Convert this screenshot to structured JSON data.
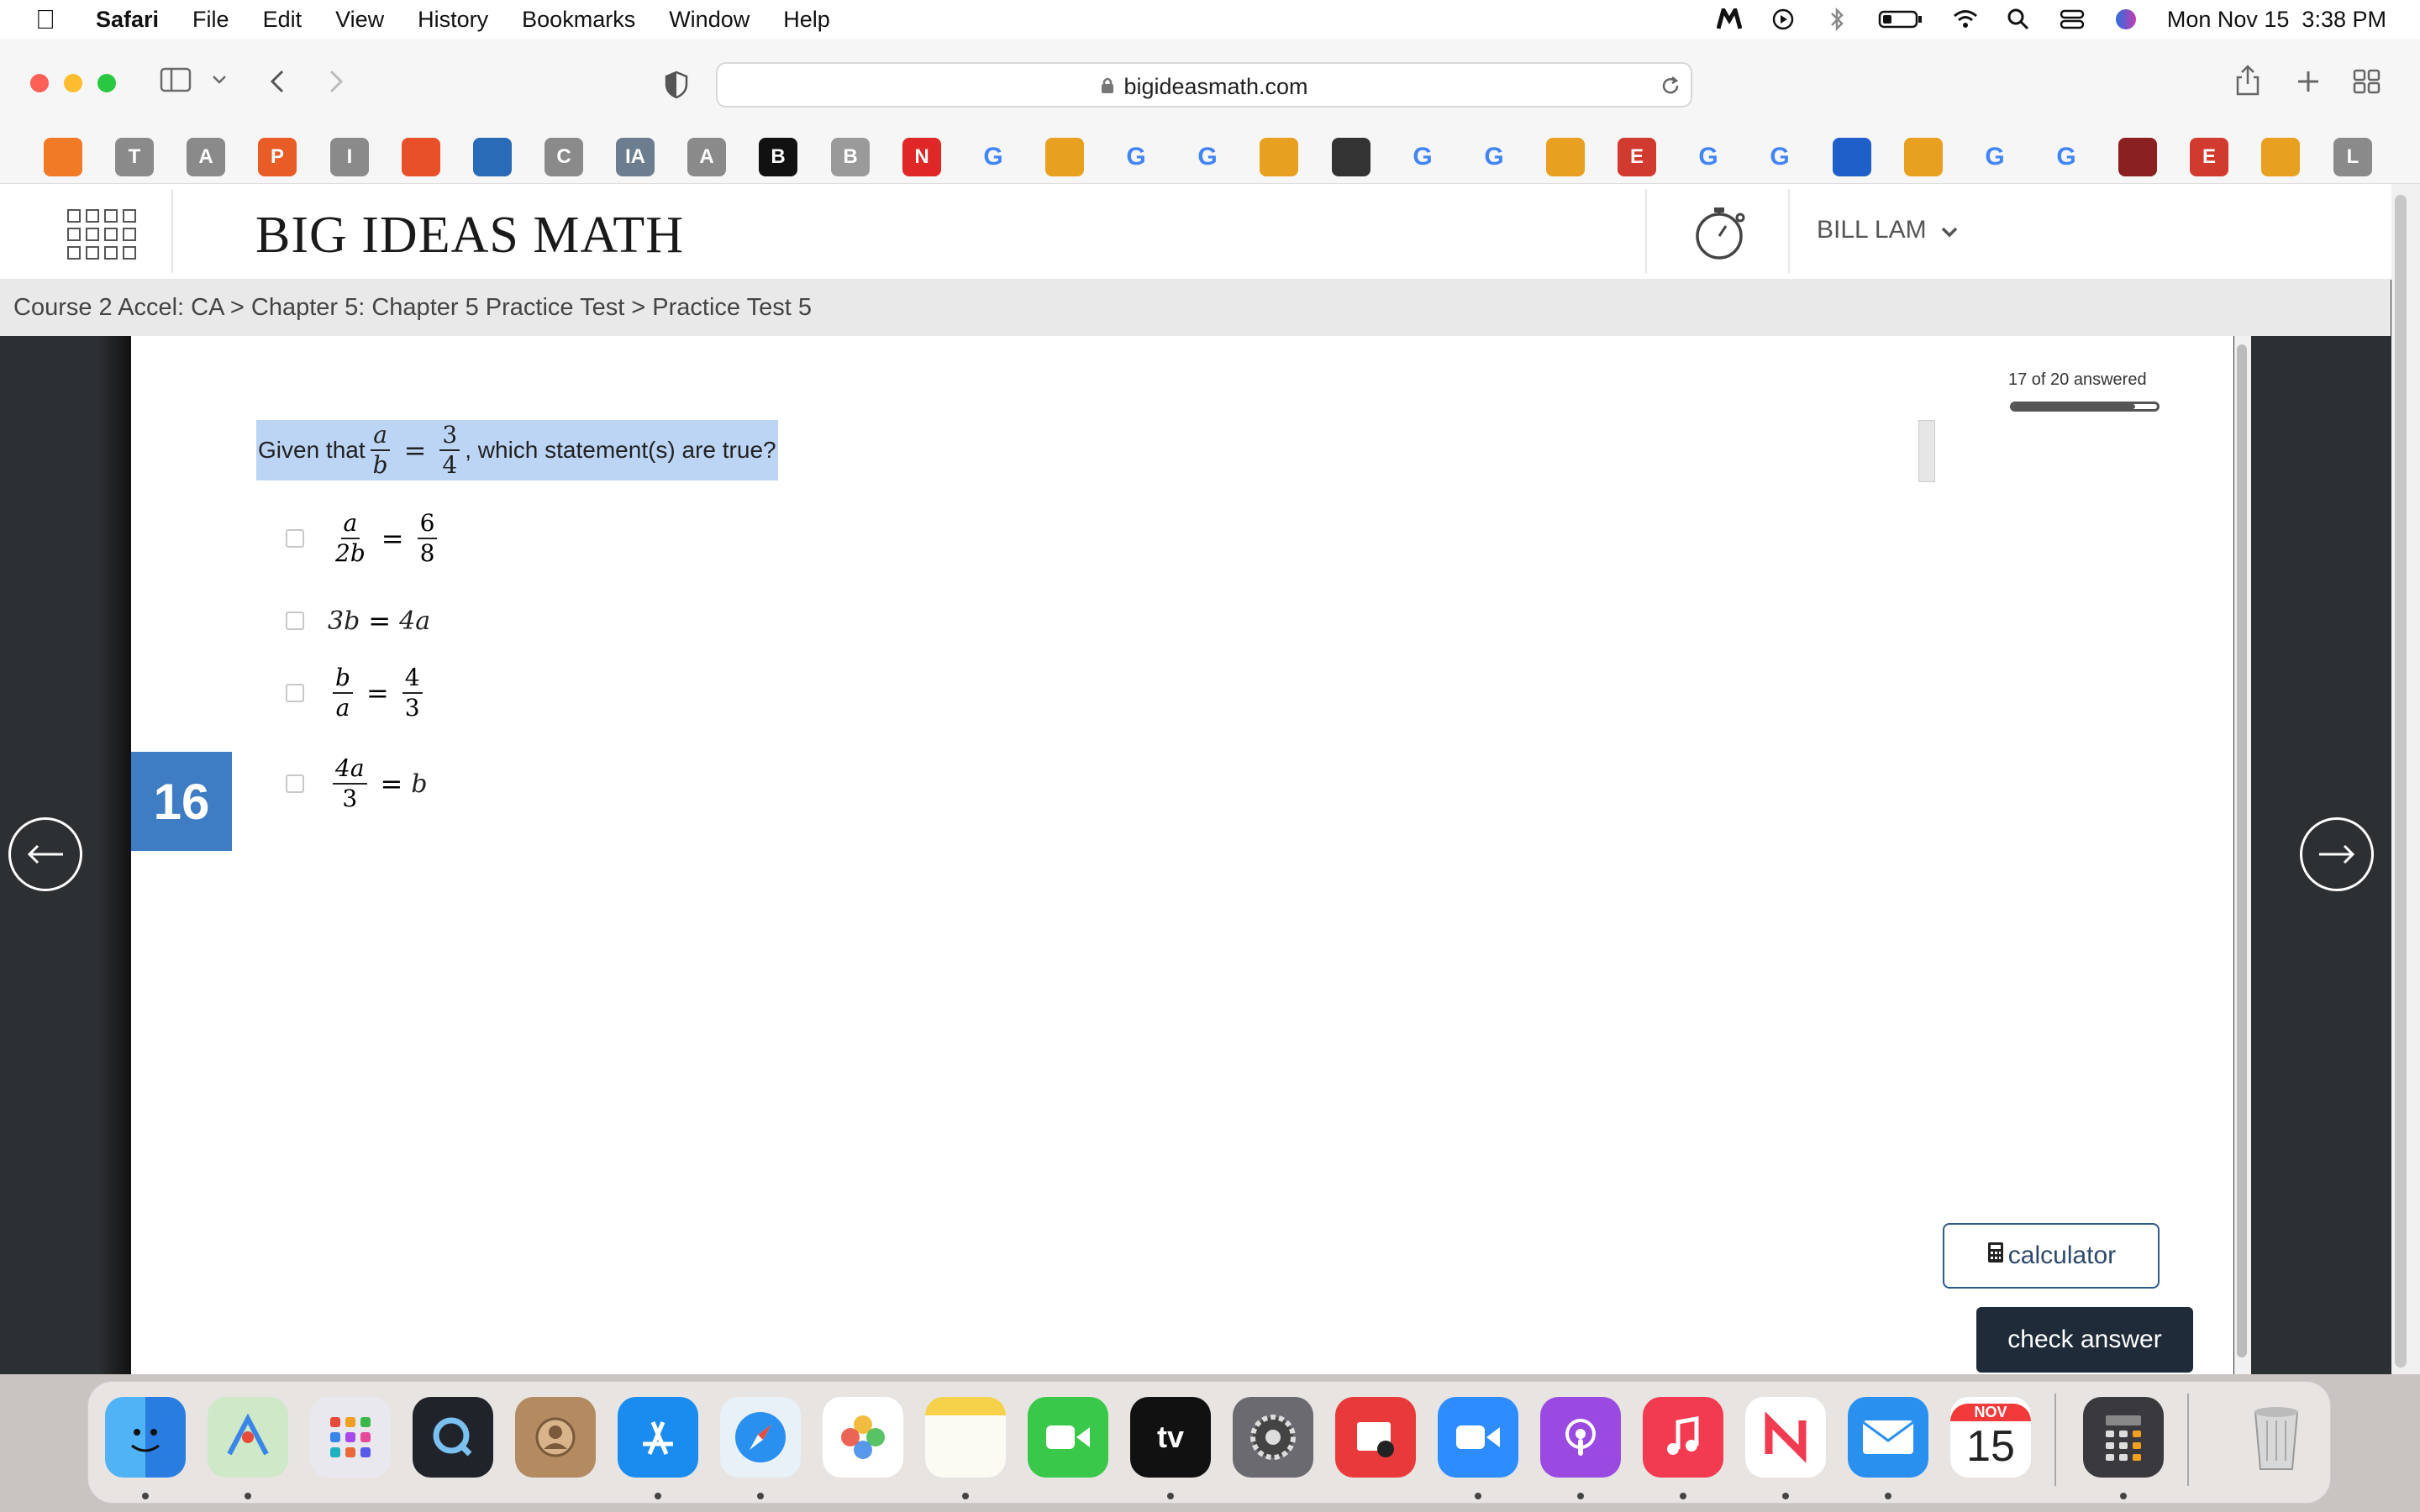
{
  "menubar": {
    "app": "Safari",
    "items": [
      "File",
      "Edit",
      "View",
      "History",
      "Bookmarks",
      "Window",
      "Help"
    ],
    "clock": "Mon Nov 15  3:38 PM",
    "status_icons": [
      "malwarebytes-icon",
      "play-icon",
      "bluetooth-icon",
      "battery-icon",
      "wifi-icon",
      "spotlight-icon",
      "control-center-icon",
      "siri-icon"
    ]
  },
  "browser": {
    "url": "bigideasmath.com"
  },
  "favorites": [
    {
      "label": "",
      "color": "#f07a26"
    },
    {
      "label": "T",
      "color": "#8a8a8a"
    },
    {
      "label": "A",
      "color": "#8a8a8a"
    },
    {
      "label": "P",
      "color": "#e85c27"
    },
    {
      "label": "I",
      "color": "#8a8a8a"
    },
    {
      "label": "",
      "color": "#e8502a"
    },
    {
      "label": "",
      "color": "#2a6bb8"
    },
    {
      "label": "C",
      "color": "#8a8a8a"
    },
    {
      "label": "IA",
      "color": "#6b7d8e"
    },
    {
      "label": "A",
      "color": "#8a8a8a"
    },
    {
      "label": "B",
      "color": "#111111"
    },
    {
      "label": "B",
      "color": "#9a9a9a"
    },
    {
      "label": "N",
      "color": "#e02727"
    },
    {
      "label": "G",
      "color": "#4285f4"
    },
    {
      "label": "",
      "color": "#e8a020"
    },
    {
      "label": "G",
      "color": "#4285f4"
    },
    {
      "label": "G",
      "color": "#4285f4"
    },
    {
      "label": "",
      "color": "#e8a020"
    },
    {
      "label": "",
      "color": "#333333"
    },
    {
      "label": "G",
      "color": "#4285f4"
    },
    {
      "label": "G",
      "color": "#4285f4"
    },
    {
      "label": "",
      "color": "#e8a020"
    },
    {
      "label": "E",
      "color": "#d13a2f"
    },
    {
      "label": "G",
      "color": "#4285f4"
    },
    {
      "label": "G",
      "color": "#4285f4"
    },
    {
      "label": "",
      "color": "#1f5fc9"
    },
    {
      "label": "",
      "color": "#e8a020"
    },
    {
      "label": "G",
      "color": "#4285f4"
    },
    {
      "label": "G",
      "color": "#4285f4"
    },
    {
      "label": "",
      "color": "#8a2020"
    },
    {
      "label": "E",
      "color": "#d13a2f"
    },
    {
      "label": "",
      "color": "#e8a020"
    },
    {
      "label": "L",
      "color": "#8a8a8a"
    }
  ],
  "site": {
    "logo": "BIG IDEAS MATH",
    "user": "BILL LAM"
  },
  "breadcrumb": "Course 2 Accel: CA > Chapter 5: Chapter 5 Practice Test > Practice Test 5",
  "progress": {
    "label": "17 of 20 answered",
    "fraction": 0.85
  },
  "question": {
    "number": "16",
    "prefix": "Given that",
    "lhs_num": "a",
    "lhs_den": "b",
    "eq": "=",
    "rhs_num": "3",
    "rhs_den": "4",
    "suffix": ", which statement(s) are true?"
  },
  "options": [
    {
      "a_num": "a",
      "a_den": "2b",
      "eq": "=",
      "b_num": "6",
      "b_den": "8"
    },
    {
      "left": "3b",
      "eq": "=",
      "right": "4a"
    },
    {
      "a_num": "b",
      "a_den": "a",
      "eq": "=",
      "b_num": "4",
      "b_den": "3"
    },
    {
      "a_num": "4a",
      "a_den": "3",
      "eq": "=",
      "right": "b"
    }
  ],
  "buttons": {
    "calculator": "calculator",
    "check": "check answer"
  },
  "dock": {
    "calendar_month": "NOV",
    "calendar_day": "15"
  }
}
